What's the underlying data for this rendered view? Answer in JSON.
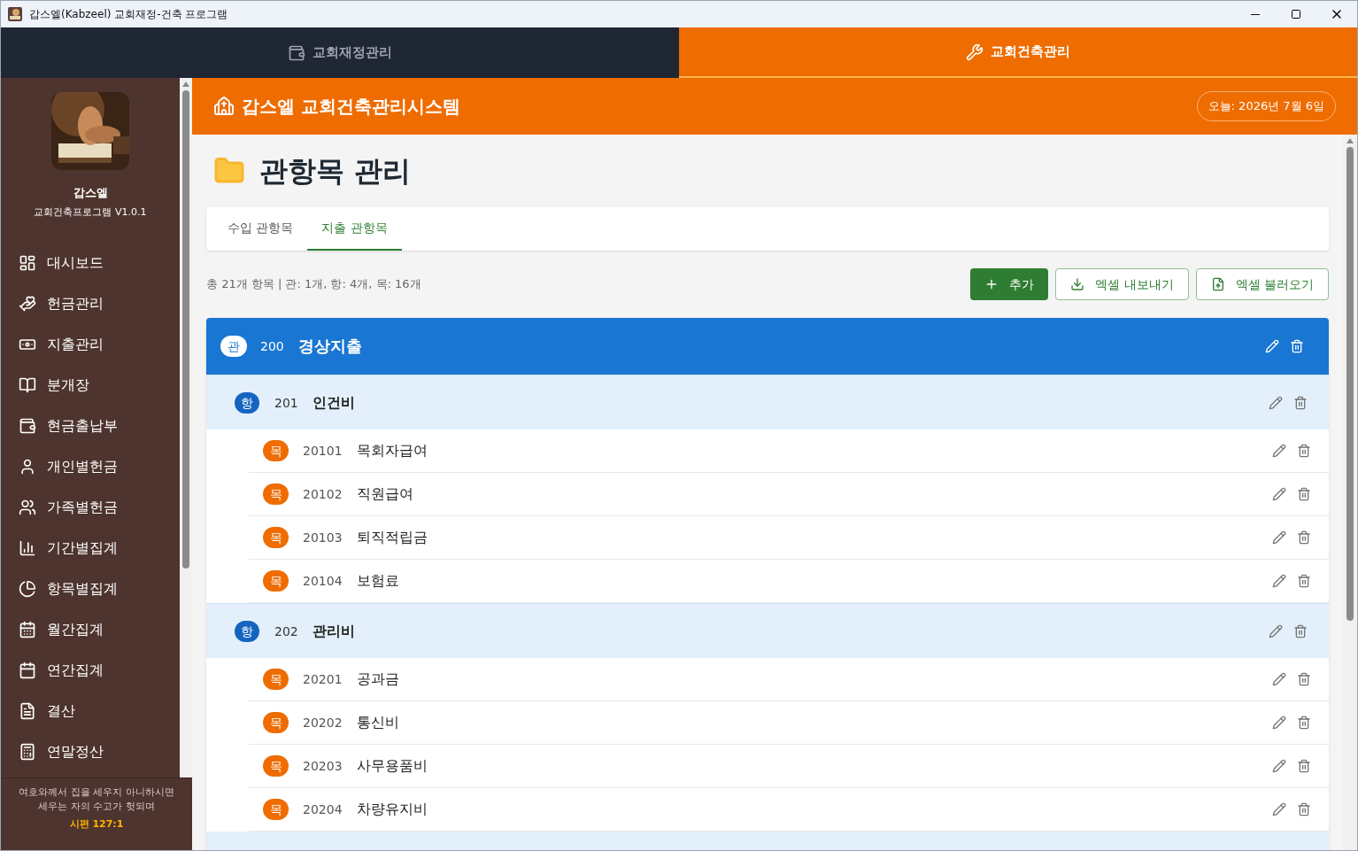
{
  "window": {
    "title": "갑스엘(Kabzeel) 교회재정-건축 프로그램"
  },
  "top_tabs": [
    {
      "label": "교회재정관리",
      "selected": false,
      "kind": "wallet"
    },
    {
      "label": "교회건축관리",
      "selected": true,
      "kind": "tools"
    }
  ],
  "sidebar": {
    "app_name": "갑스엘",
    "version": "교회건축프로그램 V1.0.1",
    "items": [
      {
        "label": "대시보드",
        "kind": "dashboard"
      },
      {
        "label": "헌금관리",
        "kind": "offering"
      },
      {
        "label": "지출관리",
        "kind": "money"
      },
      {
        "label": "분개장",
        "kind": "book"
      },
      {
        "label": "현금출납부",
        "kind": "wallet"
      },
      {
        "label": "개인별헌금",
        "kind": "person"
      },
      {
        "label": "가족별헌금",
        "kind": "family"
      },
      {
        "label": "기간별집계",
        "kind": "bars"
      },
      {
        "label": "항목별집계",
        "kind": "pie"
      },
      {
        "label": "월간집계",
        "kind": "calendar-grid"
      },
      {
        "label": "연간집계",
        "kind": "calendar"
      },
      {
        "label": "결산",
        "kind": "file"
      },
      {
        "label": "연말정산",
        "kind": "calculator"
      }
    ],
    "verse": {
      "lines": [
        "여호와께서 집을 세우지 아니하시면",
        "세우는 자의 수고가 헛되며"
      ],
      "reference": "시편 127:1"
    }
  },
  "header": {
    "title": "갑스엘 교회건축관리시스템",
    "date": "오늘: 2026년 7월 6일"
  },
  "page": {
    "title": "관항목 관리",
    "tabs": [
      {
        "label": "수입 관항목",
        "selected": false
      },
      {
        "label": "지출 관항목",
        "selected": true
      }
    ],
    "summary": "총 21개 항목 | 관: 1개, 항: 4개, 목: 16개",
    "buttons": [
      {
        "label": "추가",
        "kind": "add"
      },
      {
        "label": "엑셀 내보내기",
        "kind": "export"
      },
      {
        "label": "엑셀 불러오기",
        "kind": "import"
      }
    ],
    "tree": [
      {
        "badge": "관",
        "code": "200",
        "name": "경상지출",
        "children": [
          {
            "badge": "항",
            "code": "201",
            "name": "인건비",
            "children": [
              {
                "badge": "목",
                "code": "20101",
                "name": "목회자급여"
              },
              {
                "badge": "목",
                "code": "20102",
                "name": "직원급여"
              },
              {
                "badge": "목",
                "code": "20103",
                "name": "퇴직적립금"
              },
              {
                "badge": "목",
                "code": "20104",
                "name": "보험료"
              }
            ]
          },
          {
            "badge": "항",
            "code": "202",
            "name": "관리비",
            "children": [
              {
                "badge": "목",
                "code": "20201",
                "name": "공과금"
              },
              {
                "badge": "목",
                "code": "20202",
                "name": "통신비"
              },
              {
                "badge": "목",
                "code": "20203",
                "name": "사무용품비"
              },
              {
                "badge": "목",
                "code": "20204",
                "name": "차량유지비"
              }
            ]
          }
        ]
      }
    ]
  }
}
